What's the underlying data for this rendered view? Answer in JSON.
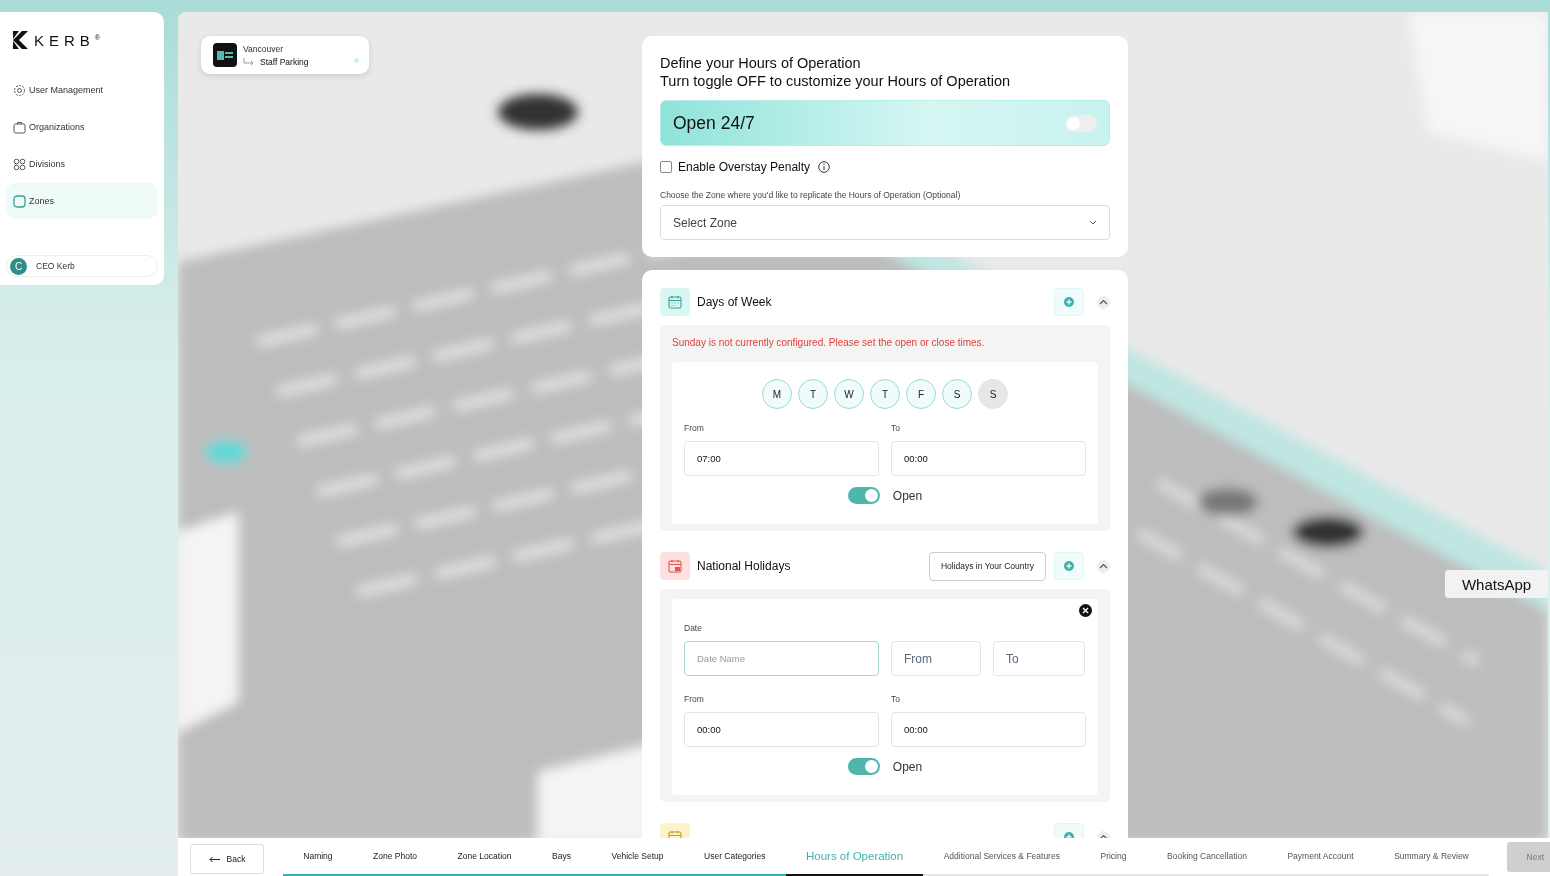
{
  "brand": "KERB",
  "brand_mark": "®",
  "sidebar": {
    "items": [
      {
        "label": "User Management",
        "kind": "gear",
        "selected": false
      },
      {
        "label": "Organizations",
        "kind": "briefcase",
        "selected": false
      },
      {
        "label": "Divisions",
        "kind": "circles",
        "selected": false
      },
      {
        "label": "Zones",
        "kind": "zone",
        "selected": true
      }
    ],
    "user": {
      "initial": "C",
      "name": "CEO Kerb"
    }
  },
  "zone_chip": {
    "city": "Vancouver",
    "zone": "Staff Parking"
  },
  "hours_card": {
    "title_lines": [
      "Define your Hours of Operation",
      "Turn toggle OFF to customize your Hours of Operation"
    ],
    "open247": {
      "label": "Open 24/7",
      "on": false
    },
    "overstay": {
      "label": "Enable Overstay Penalty",
      "checked": false
    },
    "replicate_label": "Choose the Zone where you'd like to replicate the Hours of Operation (Optional)",
    "zone_select": {
      "placeholder": "Select Zone"
    }
  },
  "sections": [
    {
      "kind": "days",
      "title": "Days of Week",
      "expanded": true,
      "warning": "Sunday is not currently configured. Please set the open or close times.",
      "days": [
        {
          "label": "M",
          "selected": true
        },
        {
          "label": "T",
          "selected": true
        },
        {
          "label": "W",
          "selected": true
        },
        {
          "label": "T",
          "selected": true
        },
        {
          "label": "F",
          "selected": true
        },
        {
          "label": "S",
          "selected": true
        },
        {
          "label": "S",
          "selected": false
        }
      ],
      "from_label": "From",
      "from": "07:00",
      "to_label": "To",
      "to": "00:00",
      "open": {
        "label": "Open",
        "on": true
      }
    },
    {
      "kind": "holidays",
      "title": "National Holidays",
      "expanded": true,
      "action": "Holidays in Your Country",
      "date_label": "Date",
      "date_name": {
        "placeholder": "Date Name",
        "focused": true
      },
      "date_from": {
        "placeholder": "From"
      },
      "date_to": {
        "placeholder": "To"
      },
      "from_label": "From",
      "from": "00:00",
      "to_label": "To",
      "to": "00:00",
      "open": {
        "label": "Open",
        "on": true
      }
    },
    {
      "kind": "specific",
      "expanded": true
    }
  ],
  "back": "Back",
  "steps": [
    {
      "label": "Naming",
      "completed": true,
      "selected": false
    },
    {
      "label": "Zone Photo",
      "completed": true,
      "selected": false
    },
    {
      "label": "Zone Location",
      "completed": true,
      "selected": false
    },
    {
      "label": "Bays",
      "completed": true,
      "selected": false
    },
    {
      "label": "Vehicle Setup",
      "completed": true,
      "selected": false
    },
    {
      "label": "User Categories",
      "completed": true,
      "selected": false
    },
    {
      "label": "Hours of Operation",
      "completed": false,
      "selected": true
    },
    {
      "label": "Additional Services & Features",
      "completed": false,
      "selected": false
    },
    {
      "label": "Pricing",
      "completed": false,
      "selected": false
    },
    {
      "label": "Booking Cancellation",
      "completed": false,
      "selected": false
    },
    {
      "label": "Payment Account",
      "completed": false,
      "selected": false
    },
    {
      "label": "Summary & Review",
      "completed": false,
      "selected": false
    }
  ],
  "next": {
    "label": "Next",
    "disabled": true
  },
  "whatsapp": "WhatsApp"
}
